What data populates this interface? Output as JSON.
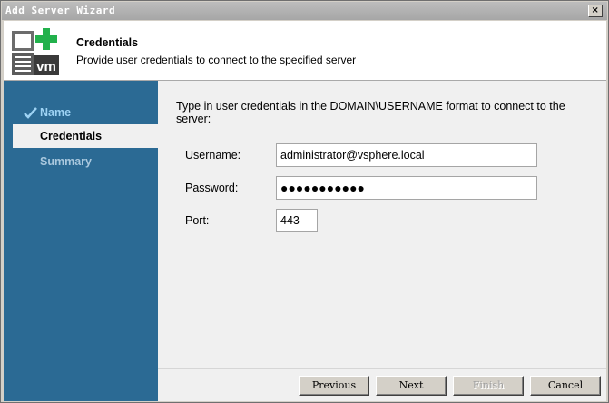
{
  "window": {
    "title": "Add Server Wizard",
    "close_glyph": "×"
  },
  "header": {
    "logo_text": "vm",
    "title": "Credentials",
    "subtitle": "Provide user credentials to connect to the specified server"
  },
  "sidebar": {
    "items": [
      {
        "label": "Name",
        "state": "completed"
      },
      {
        "label": "Credentials",
        "state": "active"
      },
      {
        "label": "Summary",
        "state": "pending"
      }
    ]
  },
  "content": {
    "instruction": "Type in user credentials in the DOMAIN\\USERNAME format to connect to the server:",
    "username": {
      "label": "Username:",
      "value": "administrator@vsphere.local"
    },
    "password": {
      "label": "Password:",
      "value": "●●●●●●●●●●●"
    },
    "port": {
      "label": "Port:",
      "value": "443"
    }
  },
  "buttons": {
    "previous": "Previous",
    "next": "Next",
    "finish": "Finish",
    "cancel": "Cancel"
  },
  "colors": {
    "sidebar": "#2b6a94",
    "active_item_bg": "#f0f0f0",
    "completed_item_text": "#9ed3f4",
    "logo_plus": "#22b14c"
  }
}
